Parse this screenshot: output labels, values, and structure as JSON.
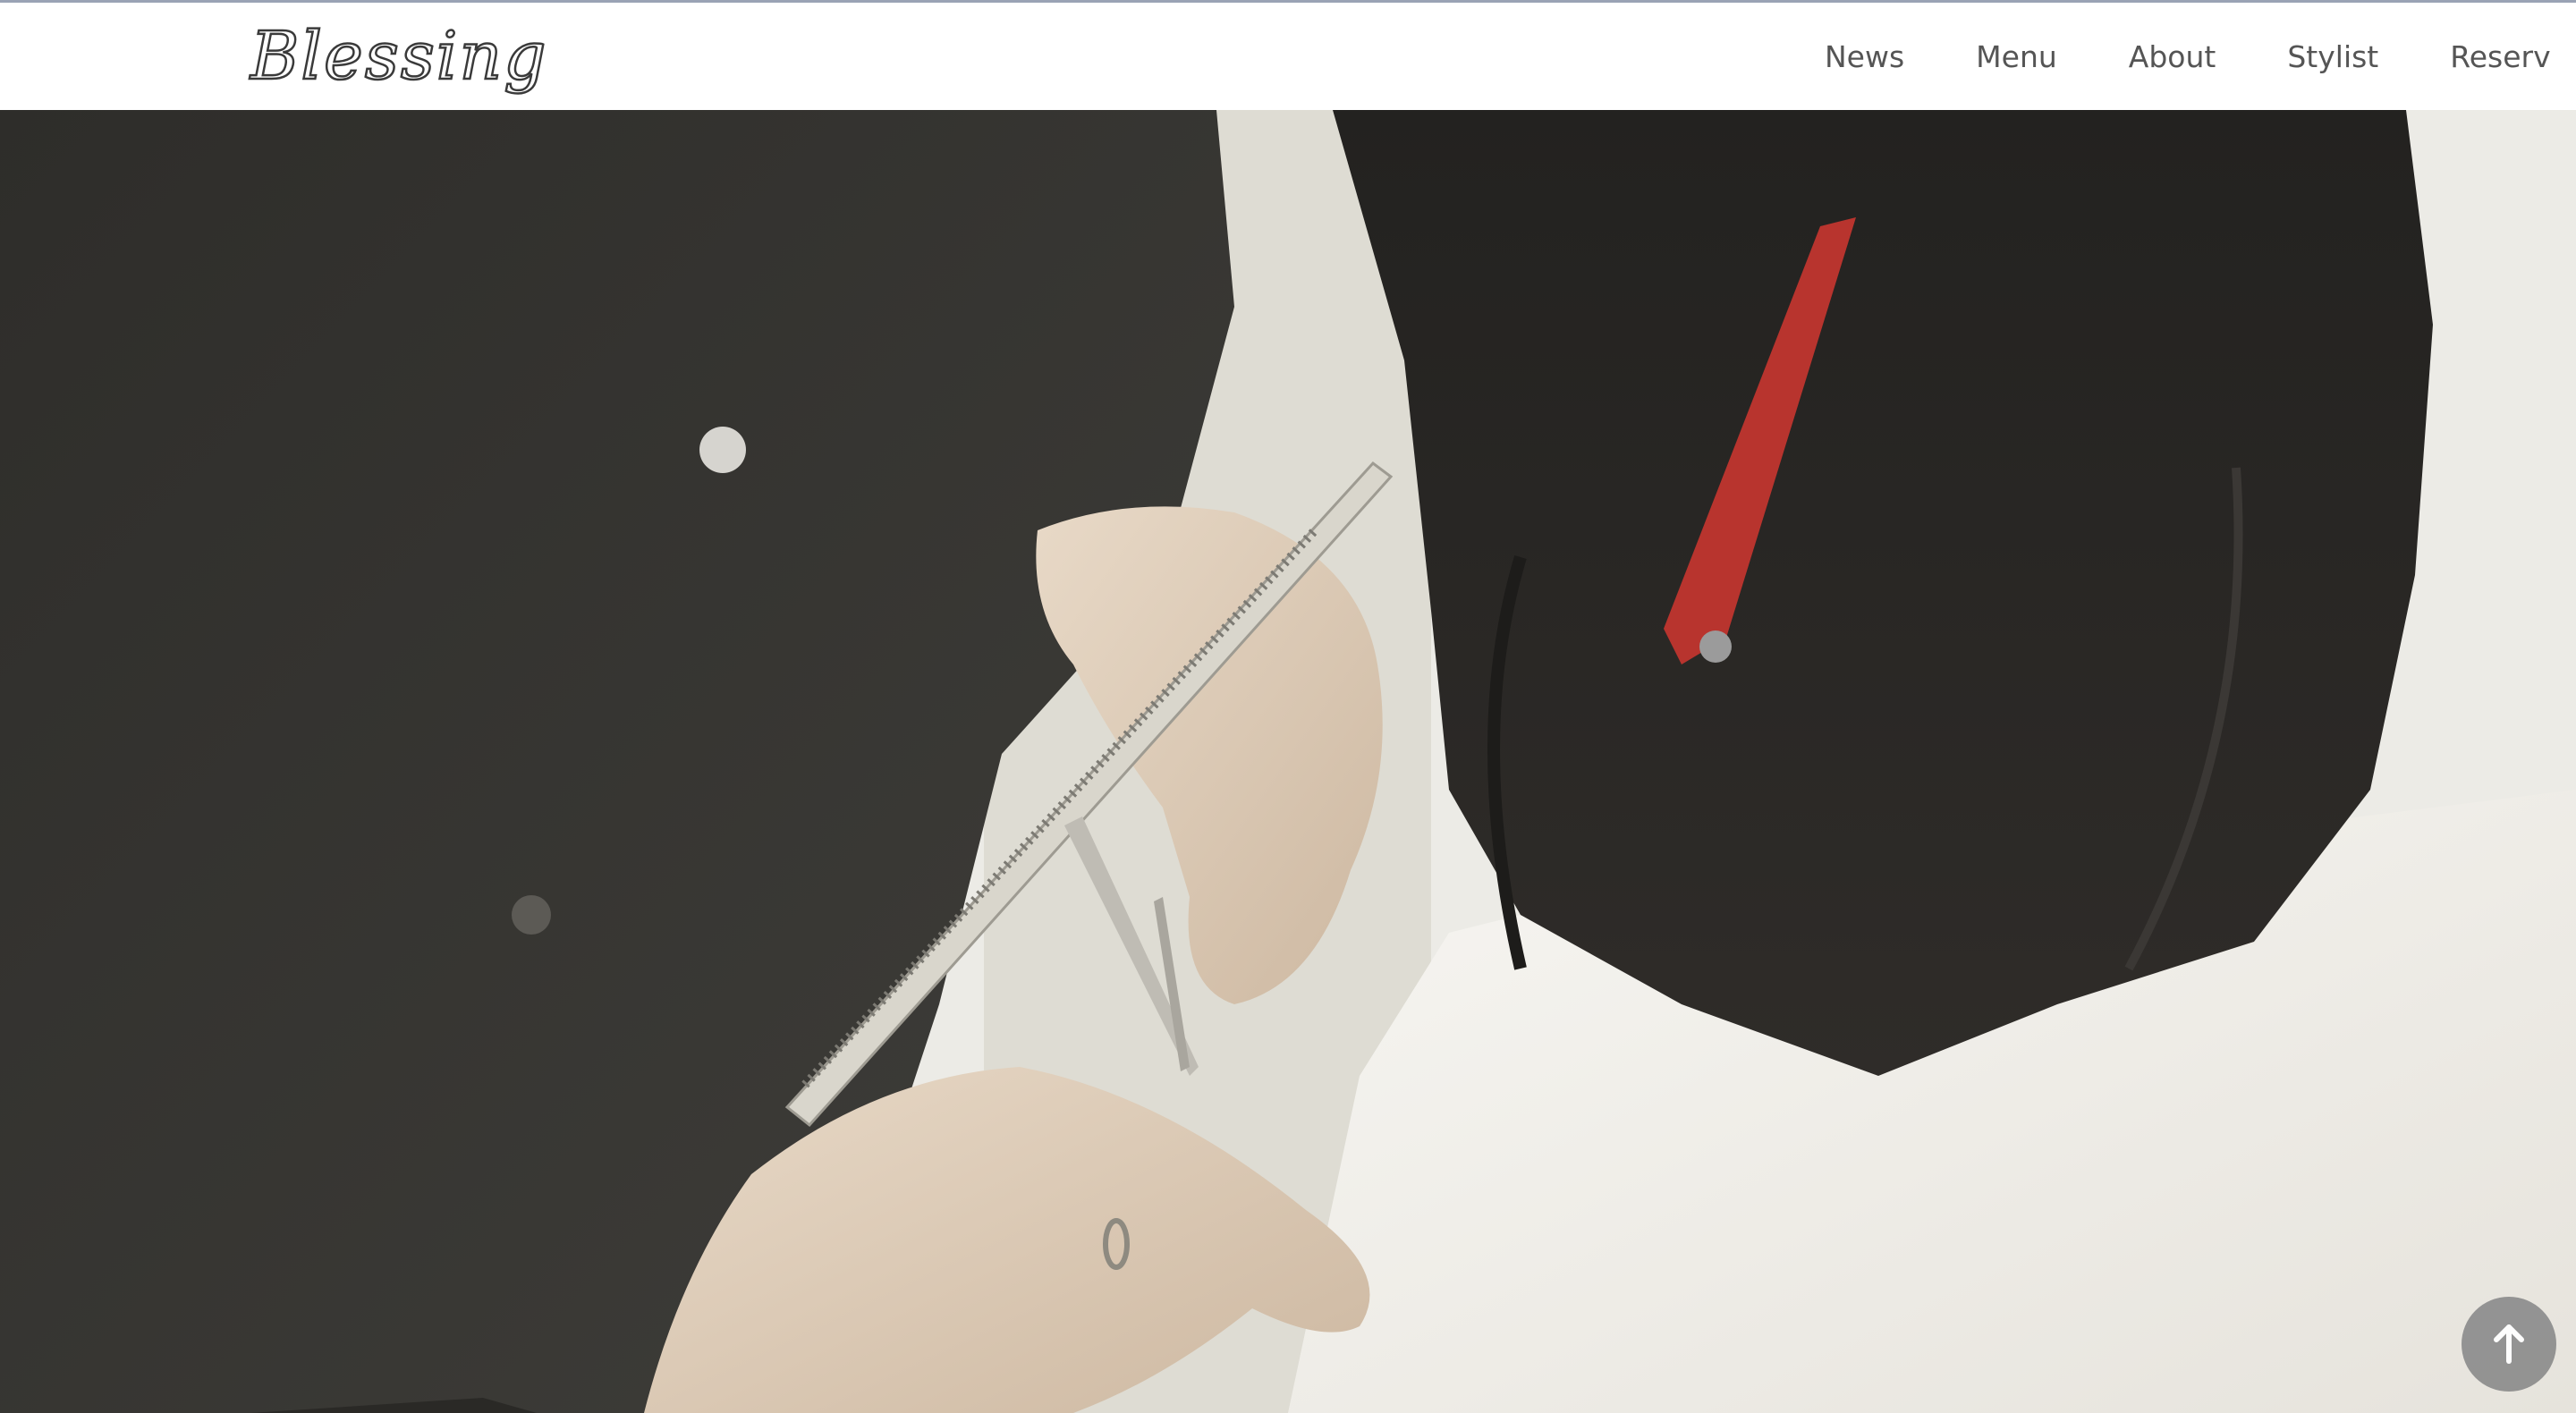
{
  "header": {
    "logo_text": "Blessing",
    "nav": [
      {
        "label": "News"
      },
      {
        "label": "Menu"
      },
      {
        "label": "About"
      },
      {
        "label": "Stylist"
      },
      {
        "label": "Reserv"
      }
    ]
  },
  "hero": {
    "image_subject": "hairstylist cutting hair with comb and scissors"
  },
  "scroll_top": {
    "icon": "arrow-up-icon"
  },
  "colors": {
    "header_bg": "#ffffff",
    "nav_text": "#555555",
    "scroll_button": "#8f8f8f",
    "top_border": "#9aa3b5"
  }
}
